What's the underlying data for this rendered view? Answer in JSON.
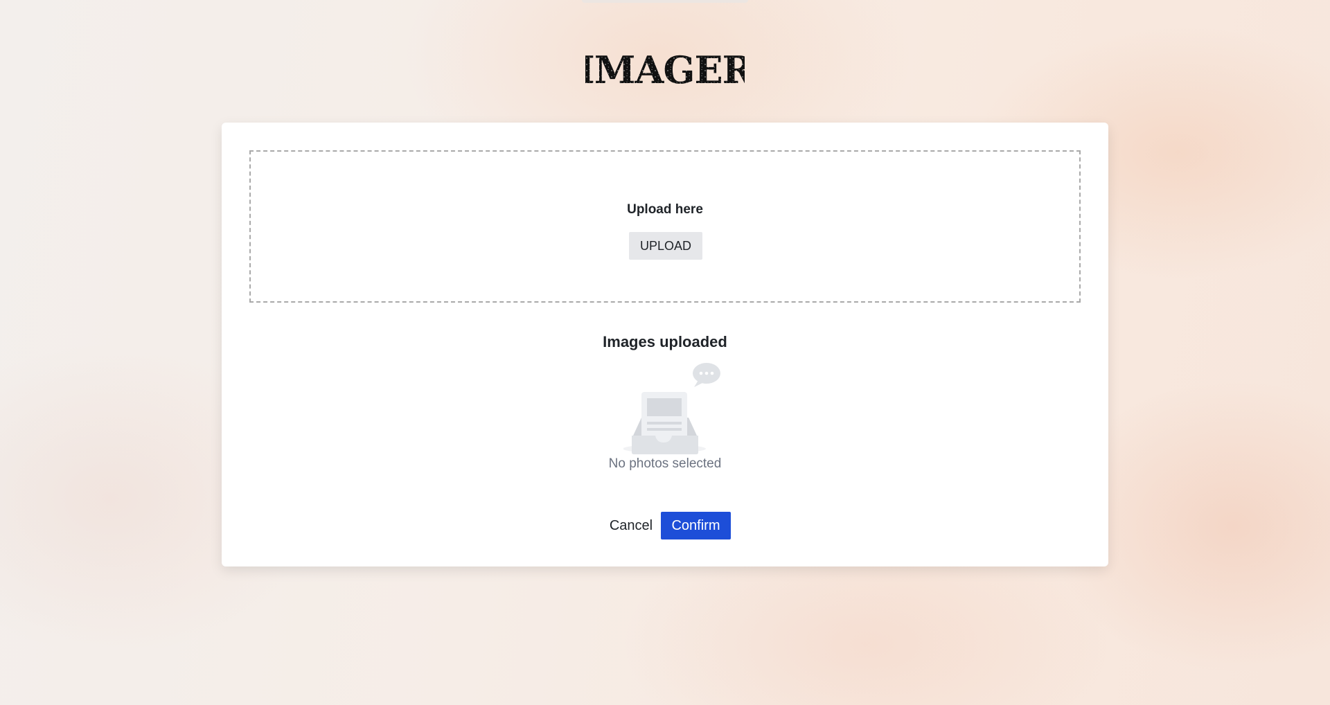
{
  "app": {
    "logo_text": "IMAGER"
  },
  "dropzone": {
    "title": "Upload here",
    "upload_label": "UPLOAD"
  },
  "uploaded": {
    "title": "Images uploaded",
    "empty_text": "No photos selected",
    "empty_icon": "empty-inbox-icon"
  },
  "actions": {
    "cancel_label": "Cancel",
    "confirm_label": "Confirm"
  },
  "colors": {
    "confirm_bg": "#1d4ed8",
    "upload_bg": "#e6e7ea",
    "dropzone_border": "#a9a9a9"
  }
}
